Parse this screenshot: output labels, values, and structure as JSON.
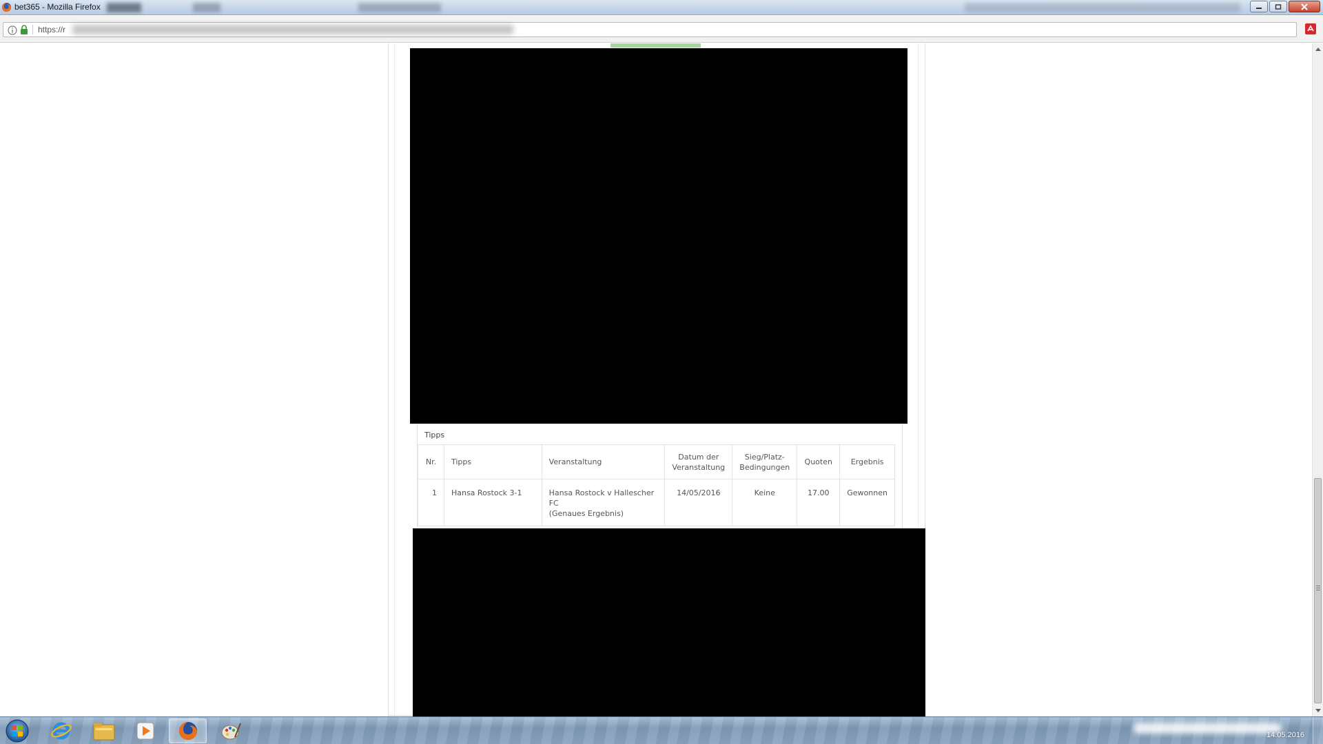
{
  "window": {
    "title": "bet365 - Mozilla Firefox"
  },
  "address_bar": {
    "url_visible": "https://r"
  },
  "tipps": {
    "panel_title": "Tipps",
    "columns": [
      "Nr.",
      "Tipps",
      "Veranstaltung",
      "Datum der\nVeranstaltung",
      "Sieg/Platz-\nBedingungen",
      "Quoten",
      "Ergebnis"
    ],
    "rows": [
      {
        "nr": "1",
        "tipp": "Hansa Rostock 3-1",
        "veranstaltung": "Hansa Rostock v Hallescher\nFC\n(Genaues Ergebnis)",
        "datum": "14/05/2016",
        "bedingungen": "Keine",
        "quote": "17.00",
        "ergebnis": "Gewonnen"
      }
    ]
  },
  "taskbar": {
    "date": "14.05.2016",
    "apps": [
      "start-orb",
      "internet-explorer-icon",
      "file-explorer-icon",
      "media-player-icon",
      "firefox-icon",
      "paint-icon"
    ]
  },
  "colors": {
    "accent_green": "#a6d5a0",
    "redaction": "#000000"
  }
}
